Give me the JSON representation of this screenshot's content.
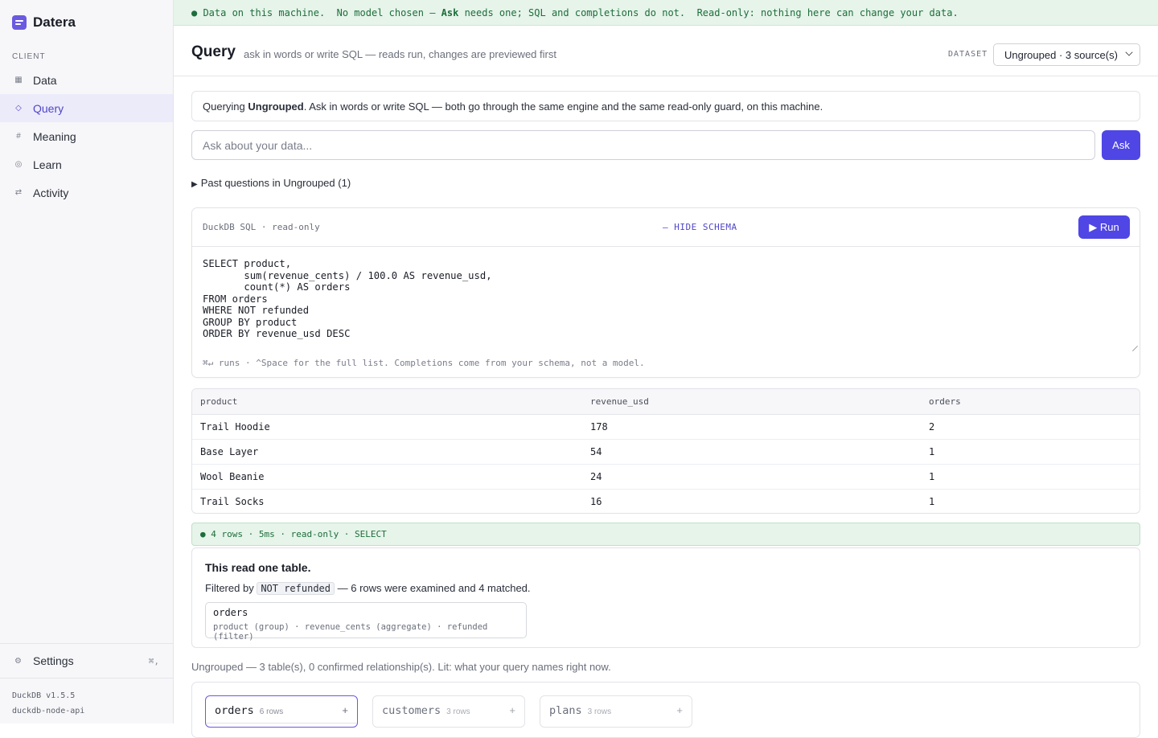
{
  "app": {
    "name": "Datera",
    "section_label": "CLIENT",
    "nav": [
      {
        "label": "Data",
        "icon": "table-icon",
        "glyph": "▦"
      },
      {
        "label": "Query",
        "icon": "query-diamond-icon",
        "glyph": "◇"
      },
      {
        "label": "Meaning",
        "icon": "hash-icon",
        "glyph": "#"
      },
      {
        "label": "Learn",
        "icon": "target-icon",
        "glyph": "◎"
      },
      {
        "label": "Activity",
        "icon": "swap-arrows-icon",
        "glyph": "⇄"
      }
    ],
    "active_nav": "Query",
    "settings": {
      "label": "Settings",
      "glyph": "⚙",
      "shortcut": "⌘,"
    },
    "version_line1": "DuckDB v1.5.5",
    "version_line2": "duckdb-node-api"
  },
  "banner": {
    "part1": "● Data on this machine.  No model chosen — ",
    "bold": "Ask",
    "part2": " needs one; SQL and completions do not.  Read-only: nothing here can change your data."
  },
  "header": {
    "title": "Query",
    "subtitle": "ask in words or write SQL — reads run, changes are previewed first",
    "dataset_label": "DATASET",
    "dataset_value": "Ungrouped · 3 source(s)"
  },
  "info": {
    "prefix": "Querying ",
    "dataset": "Ungrouped",
    "suffix": ". Ask in words or write SQL — both go through the same engine and the same read-only guard, on this machine."
  },
  "ask": {
    "placeholder": "Ask about your data...",
    "button": "Ask"
  },
  "past_questions": "Past questions in Ungrouped (1)",
  "editor": {
    "tag": "DuckDB SQL · read-only",
    "hide_schema": "— HIDE SCHEMA",
    "run": "▶ Run",
    "sql": "SELECT product,\n       sum(revenue_cents) / 100.0 AS revenue_usd,\n       count(*) AS orders\nFROM orders\nWHERE NOT refunded\nGROUP BY product\nORDER BY revenue_usd DESC",
    "hint": "⌘↵ runs · ^Space for the full list. Completions come from your schema, not a model."
  },
  "results": {
    "columns": [
      "product",
      "revenue_usd",
      "orders"
    ],
    "rows": [
      [
        "Trail Hoodie",
        "178",
        "2"
      ],
      [
        "Base Layer",
        "54",
        "1"
      ],
      [
        "Wool Beanie",
        "24",
        "1"
      ],
      [
        "Trail Socks",
        "16",
        "1"
      ]
    ],
    "status": "● 4 rows · 5ms · read-only · SELECT"
  },
  "explain": {
    "title": "This read one table.",
    "filter_prefix": "Filtered by ",
    "filter_code": "NOT refunded",
    "filter_suffix": " — 6 rows were examined and 4 matched.",
    "table_name": "orders",
    "table_cols": "product (group) · revenue_cents (aggregate) · refunded (filter)"
  },
  "schema": {
    "summary": "Ungrouped — 3 table(s), 0 confirmed relationship(s). Lit: what your query names right now.",
    "tables": [
      {
        "name": "orders",
        "rows": "6 rows",
        "plus": "+"
      },
      {
        "name": "customers",
        "rows": "3 rows",
        "plus": "+"
      },
      {
        "name": "plans",
        "rows": "3 rows",
        "plus": "+"
      }
    ]
  },
  "colors": {
    "accent": "#4f46e5",
    "banner_bg": "#e6f4ea",
    "banner_text": "#1d6e3a",
    "active_nav_bg": "#ecebfa"
  }
}
